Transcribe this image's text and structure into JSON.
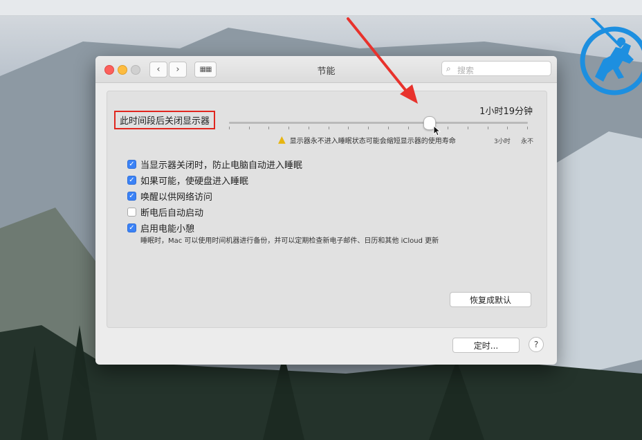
{
  "window": {
    "title": "节能",
    "search_placeholder": "搜索"
  },
  "slider": {
    "label": "此时间段后关闭显示器",
    "value_text": "1小时19分钟",
    "value_fraction": 0.67,
    "warning": "显示器永不进入睡眠状态可能会缩短显示器的使用寿命",
    "tick_labels": {
      "three_hours": "3小时",
      "never": "永不"
    }
  },
  "options": [
    {
      "label": "当显示器关闭时，防止电脑自动进入睡眠",
      "checked": true
    },
    {
      "label": "如果可能，使硬盘进入睡眠",
      "checked": true
    },
    {
      "label": "唤醒以供网络访问",
      "checked": true
    },
    {
      "label": "断电后自动启动",
      "checked": false
    },
    {
      "label": "启用电能小憩",
      "checked": true
    }
  ],
  "power_nap_desc": "睡眠时，Mac 可以使用时间机器进行备份，并可以定期检查新电子邮件、日历和其他 iCloud 更新",
  "buttons": {
    "restore": "恢复成默认",
    "schedule": "定时...",
    "help": "?"
  },
  "colors": {
    "highlight_box": "#e0261e",
    "annotation_arrow": "#e8322c",
    "checkbox": "#3b82f6"
  },
  "icons": [
    "chevron-left-icon",
    "chevron-right-icon",
    "grid-icon",
    "search-icon",
    "warning-icon",
    "help-icon",
    "knight-logo"
  ]
}
